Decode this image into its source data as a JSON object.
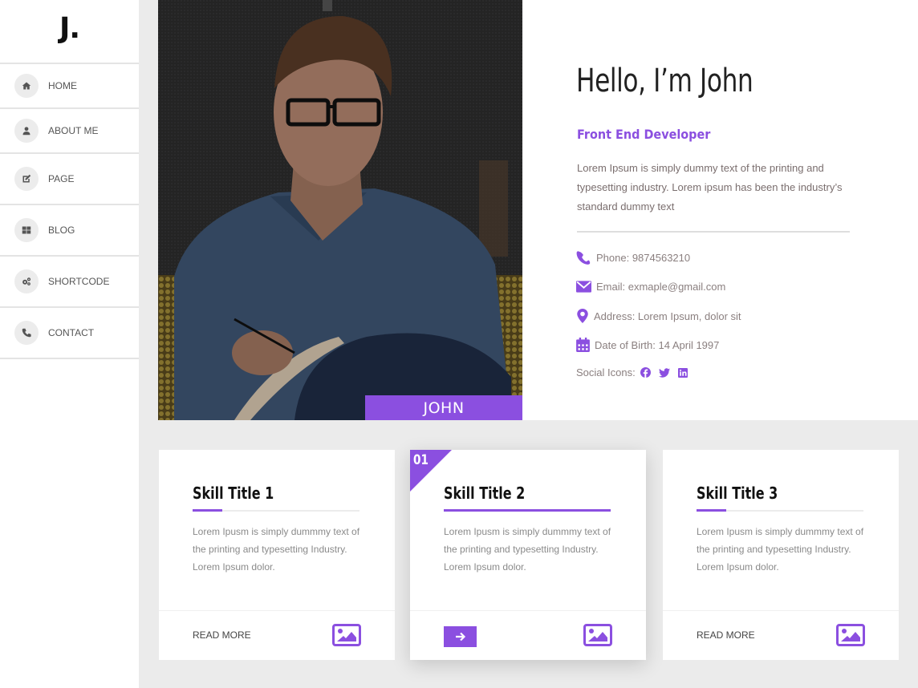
{
  "brand": {
    "logo": "J.",
    "accent": "#8b4fe0"
  },
  "sidebar": {
    "items": [
      {
        "label": "HOME",
        "icon": "home-icon"
      },
      {
        "label": "ABOUT ME",
        "icon": "user-icon"
      },
      {
        "label": "PAGE",
        "icon": "edit-icon"
      },
      {
        "label": "BLOG",
        "icon": "grid-icon"
      },
      {
        "label": "SHORTCODE",
        "icon": "cogs-icon"
      },
      {
        "label": "CONTACT",
        "icon": "phone-icon"
      }
    ]
  },
  "hero": {
    "photo_caption": "JOHN",
    "heading": "Hello, I’m John",
    "role": "Front End Developer",
    "bio": "Lorem Ipsum is simply dummy text of the printing and typesetting industry. Lorem ipsum has been the industry’s standard dummy text",
    "contact": {
      "phone": "Phone: 9874563210",
      "email": "Email: exmaple@gmail.com",
      "address": "Address: Lorem Ipsum, dolor sit",
      "dob": "Date of Birth: 14 April 1997",
      "social_label": "Social Icons:"
    },
    "social": [
      "facebook-icon",
      "twitter-icon",
      "linkedin-icon"
    ]
  },
  "cards": [
    {
      "title": "Skill Title 1",
      "text": "Lorem Ipusm is simply dummmy text of the printing and typesetting Industry. Lorem Ipsum dolor.",
      "action": "READ MORE",
      "active": false,
      "progress": 0.18
    },
    {
      "title": "Skill Title 2",
      "text": "Lorem Ipusm is simply dummmy text of the printing and typesetting Industry. Lorem Ipsum dolor.",
      "badge": "01",
      "active": true,
      "progress": 1.0
    },
    {
      "title": "Skill Title 3",
      "text": "Lorem Ipusm is simply dummmy text of the printing and typesetting Industry. Lorem Ipsum dolor.",
      "action": "READ MORE",
      "active": false,
      "progress": 0.18
    }
  ]
}
